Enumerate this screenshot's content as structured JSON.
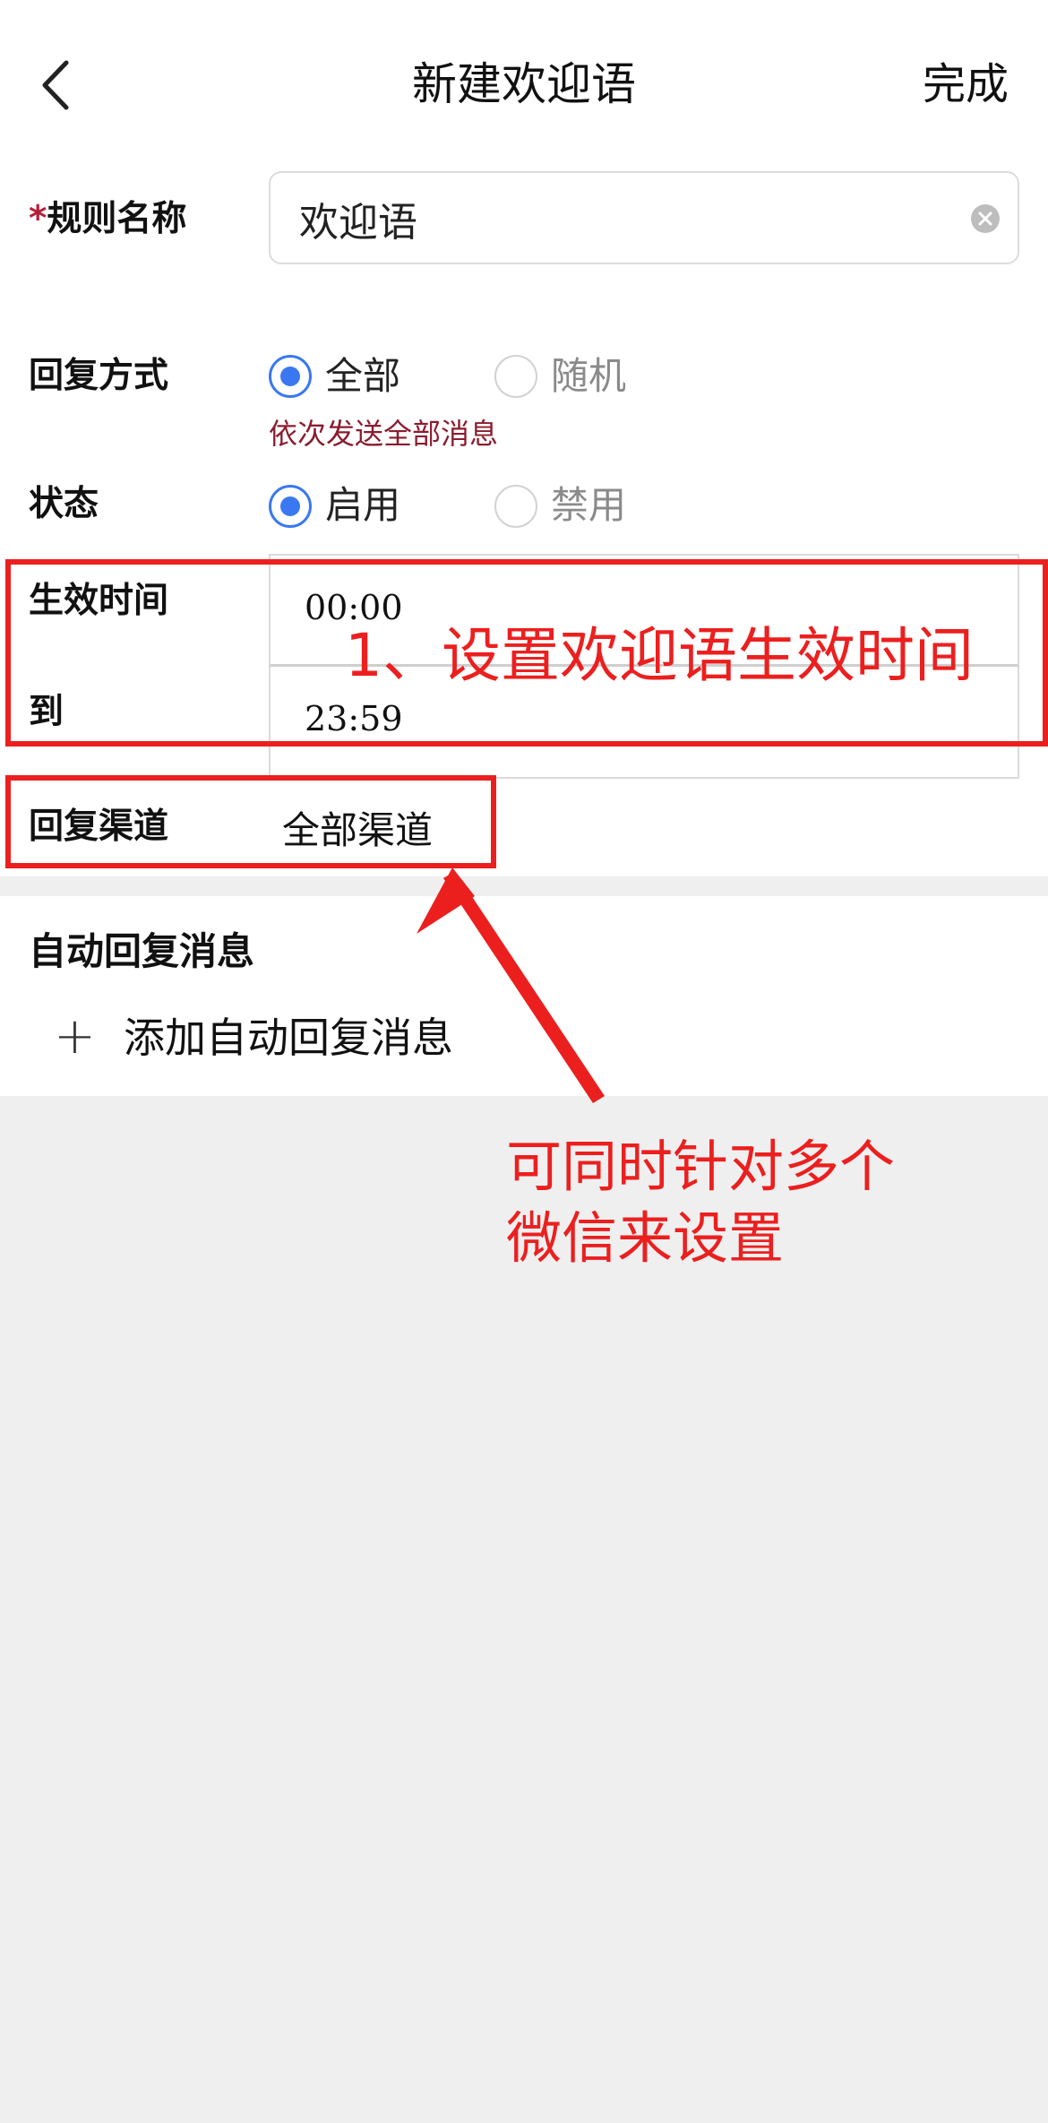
{
  "header": {
    "title": "新建欢迎语",
    "done_label": "完成"
  },
  "form": {
    "rule_name": {
      "required_mark": "*",
      "label": "规则名称",
      "value": "欢迎语"
    },
    "reply_mode": {
      "label": "回复方式",
      "options": [
        {
          "label": "全部",
          "selected": true
        },
        {
          "label": "随机",
          "selected": false
        }
      ],
      "hint": "依次发送全部消息"
    },
    "status": {
      "label": "状态",
      "options": [
        {
          "label": "启用",
          "selected": true
        },
        {
          "label": "禁用",
          "selected": false
        }
      ]
    },
    "effective_time": {
      "label": "生效时间",
      "start": "00:00",
      "end_label": "到",
      "end": "23:59"
    },
    "channel": {
      "label": "回复渠道",
      "value": "全部渠道"
    }
  },
  "auto_reply": {
    "title": "自动回复消息",
    "add_label": "添加自动回复消息"
  },
  "annotations": {
    "time_note": "1、设置欢迎语生效时间",
    "channel_note_line1": "可同时针对多个",
    "channel_note_line2": "微信来设置"
  },
  "colors": {
    "accent": "#3a78f2",
    "required": "#b51e3a",
    "hint": "#8a1c2e",
    "annotation": "#ec1f1f",
    "page_bg": "#efefef"
  },
  "icons": {
    "back": "chevron-left-icon",
    "clear": "clear-icon",
    "add": "plus-icon"
  }
}
